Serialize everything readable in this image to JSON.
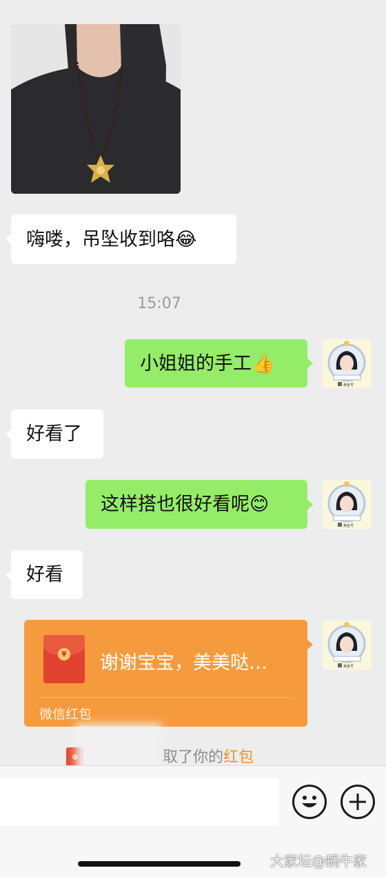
{
  "messages": {
    "received_1": "嗨喽，吊坠收到咯😂",
    "timestamp": "15:07",
    "sent_1": "小姐姐的手工👍",
    "received_2": "好看了",
    "sent_2": "这样搭也很好看呢😊",
    "received_3": "好看"
  },
  "red_packet": {
    "message": "谢谢宝宝，美美哒…",
    "brand": "微信红包"
  },
  "notice": {
    "prefix": "取了你的",
    "highlight": "红包"
  },
  "input": {
    "value": "",
    "placeholder": ""
  },
  "avatar": {
    "caption": "黄金号",
    "sign": "回家蜗牛珠宝"
  },
  "icons": [
    "emoji-face-icon",
    "plus-circle-icon",
    "red-packet-icon"
  ],
  "colors": {
    "background": "#ededed",
    "sent_bubble": "#95ec69",
    "received_bubble": "#ffffff",
    "red_packet": "#f69b3d",
    "highlight": "#f0932d"
  },
  "watermark": "大家坛@蜗牛家"
}
